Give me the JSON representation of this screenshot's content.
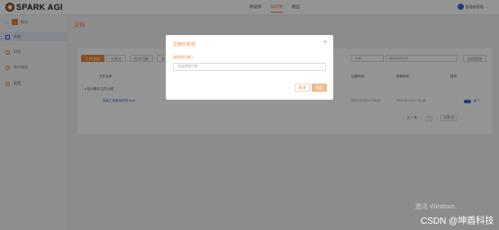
{
  "app": {
    "name": "SPARK AGI"
  },
  "topnav": {
    "items": [
      "数据库",
      "知识库",
      "模型"
    ],
    "active_index": 1
  },
  "user": {
    "name": "管理者管理"
  },
  "sidebar": {
    "back_label": "←",
    "header_label": "知识",
    "items": [
      {
        "label": "文档",
        "active": true
      },
      {
        "label": "问答",
        "active": false
      },
      {
        "label": "命中测试",
        "active": false
      },
      {
        "label": "配置",
        "active": false
      }
    ]
  },
  "main": {
    "title": "文档",
    "toolbar": {
      "upload": "上传文档",
      "btn2": "分割文",
      "btn3": "合并问题",
      "btn4": "导入链接",
      "select_value": "全部",
      "search_placeholder": "搜索文档名称",
      "manage": "分组管理"
    },
    "table": {
      "headers": [
        "文件名称",
        "创建时间",
        "更新时间",
        "操作"
      ],
      "group_label": "▸ 知识服务/文件分组",
      "rows": [
        {
          "name": "安装工具使用说明.docx",
          "created": "2024-01-02 17:51:45",
          "updated": "2024-01-02 17:51:45",
          "enabled": true
        }
      ]
    },
    "pagination": {
      "total_label": "共 1 条",
      "page": "1",
      "page_size": "10条/页"
    }
  },
  "modal": {
    "title": "文档分析前",
    "field_label": "选择知识库",
    "required_mark": "*",
    "select_placeholder": "请选择知识库",
    "cancel_label": "取消",
    "ok_label": "确定"
  },
  "watermarks": {
    "line1": "激活 Windows",
    "line2": "CSDN @坤盾科技"
  },
  "colors": {
    "accent": "#e8893a",
    "link": "#3a6bd1",
    "overlay": "rgba(0,0,0,0.42)"
  }
}
